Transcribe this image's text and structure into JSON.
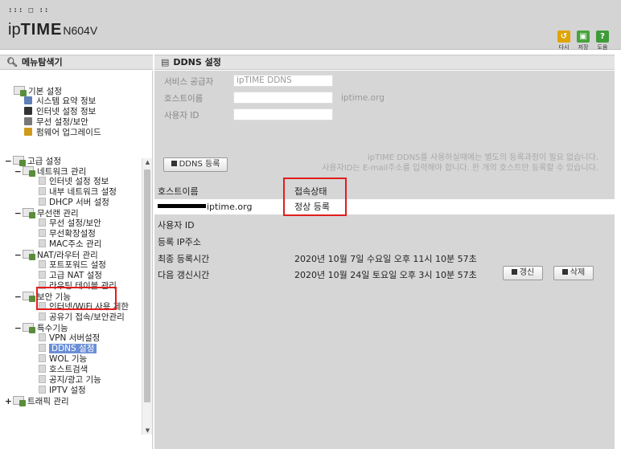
{
  "header": {
    "logo_mark": "::: □ ::",
    "logo_prefix": "ip",
    "logo_bold": "TIME",
    "logo_model": "N604V",
    "buttons": [
      {
        "icon": "reload-icon",
        "label": "다시",
        "color": "#e0a400"
      },
      {
        "icon": "save-icon",
        "label": "저장",
        "color": "#46a33a"
      },
      {
        "icon": "help-icon",
        "label": "도움",
        "color": "#3f9a3a"
      }
    ]
  },
  "sidebar": {
    "title": "메뉴탐색기",
    "basic": {
      "label": "기본 설정",
      "items": [
        "시스템 요약 정보",
        "인터넷 설정 정보",
        "무선 설정/보안",
        "펌웨어 업그레이드"
      ]
    },
    "advanced": {
      "label": "고급 설정",
      "groups": [
        {
          "label": "네트워크 관리",
          "items": [
            "인터넷 설정 정보",
            "내부 네트워크 설정",
            "DHCP 서버 설정"
          ]
        },
        {
          "label": "무선랜 관리",
          "items": [
            "무선 설정/보안",
            "무선확장설정",
            "MAC주소 관리"
          ]
        },
        {
          "label": "NAT/라우터 관리",
          "items": [
            "포트포워드 설정",
            "고급 NAT 설정",
            "라우팅 테이블 관리"
          ]
        },
        {
          "label": "보안 기능",
          "items": [
            "인터넷/WiFi 사용 제한",
            "공유기 접속/보안관리"
          ]
        },
        {
          "label": "특수기능",
          "items": [
            "VPN 서버설정",
            "DDNS 설정",
            "WOL 기능",
            "호스트검색",
            "공지/광고 기능",
            "IPTV 설정"
          ]
        }
      ],
      "traffic": "트래픽 관리"
    },
    "selected": "DDNS 설정"
  },
  "main": {
    "title": "DDNS 설정",
    "form": {
      "provider_label": "서비스 공급자",
      "provider_value": "ipTIME DDNS",
      "host_label": "호스트이름",
      "host_value": "",
      "host_suffix": "iptime.org",
      "user_label": "사용자 ID",
      "user_value": ""
    },
    "register_button": "DDNS 등록",
    "notice_line1": "ipTIME DDNS를 사용하실때에는 별도의 등록과정이 필요 없습니다.",
    "notice_line2": "사용자ID는 E-mail주소를 입력해야 합니다. 한 개의 호스트만 등록할 수 있습니다.",
    "table": {
      "col_host": "호스트이름",
      "col_status": "접속상태",
      "host_value": "iptime.org",
      "status_value": "정상 등록"
    },
    "details": {
      "user_label": "사용자 ID",
      "user_value": "",
      "ip_label": "등록 IP주소",
      "ip_value": "",
      "last_label": "최종 등록시간",
      "last_value": "2020년 10월 7일 수요일 오후 11시 10분 57초",
      "next_label": "다음 갱신시간",
      "next_value": "2020년 10월 24일 토요일 오후 3시 10분 57초"
    },
    "renew_button": "갱신",
    "delete_button": "삭제"
  }
}
